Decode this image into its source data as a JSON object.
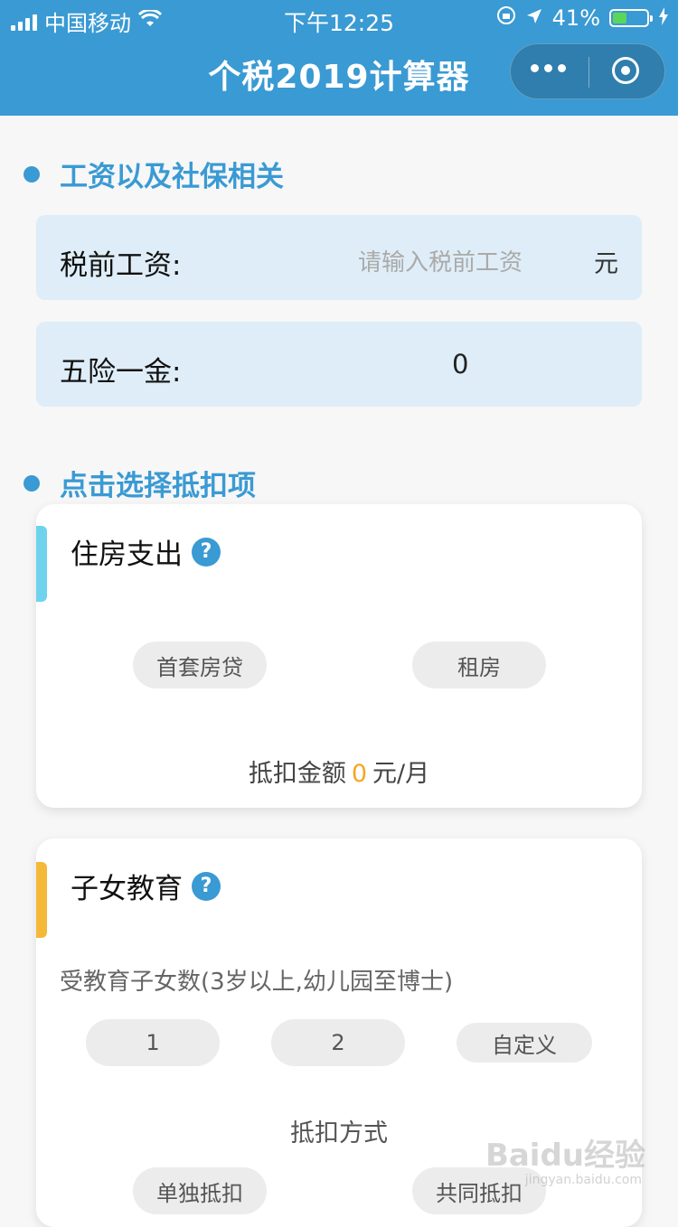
{
  "status_bar": {
    "carrier": "中国移动",
    "time": "下午12:25",
    "battery_percent": "41%",
    "battery_level": 0.41
  },
  "nav": {
    "title": "个税2019计算器"
  },
  "salary_section": {
    "title": "工资以及社保相关",
    "pretax_label": "税前工资:",
    "pretax_placeholder": "请输入税前工资",
    "pretax_unit": "元",
    "insurance_label": "五险一金:",
    "insurance_value": "0"
  },
  "deduction_section": {
    "title": "点击选择抵扣项"
  },
  "housing_card": {
    "title": "住房支出",
    "accent_color": "#6fd3ee",
    "options": [
      "首套房贷",
      "租房"
    ],
    "amount_prefix": "抵扣金额",
    "amount_value": "0",
    "amount_suffix": "元/月"
  },
  "education_card": {
    "title": "子女教育",
    "accent_color": "#f5b93a",
    "children_label": "受教育子女数(3岁以上,幼儿园至博士)",
    "children_options": [
      "1",
      "2",
      "自定义"
    ],
    "method_label": "抵扣方式",
    "method_options": [
      "单独抵扣",
      "共同抵扣"
    ]
  },
  "watermark": {
    "brand": "Baidu经验",
    "url": "jingyan.baidu.com"
  },
  "colors": {
    "primary": "#3a9ad3",
    "field_bg": "#deedf7",
    "highlight": "#f5a623"
  }
}
